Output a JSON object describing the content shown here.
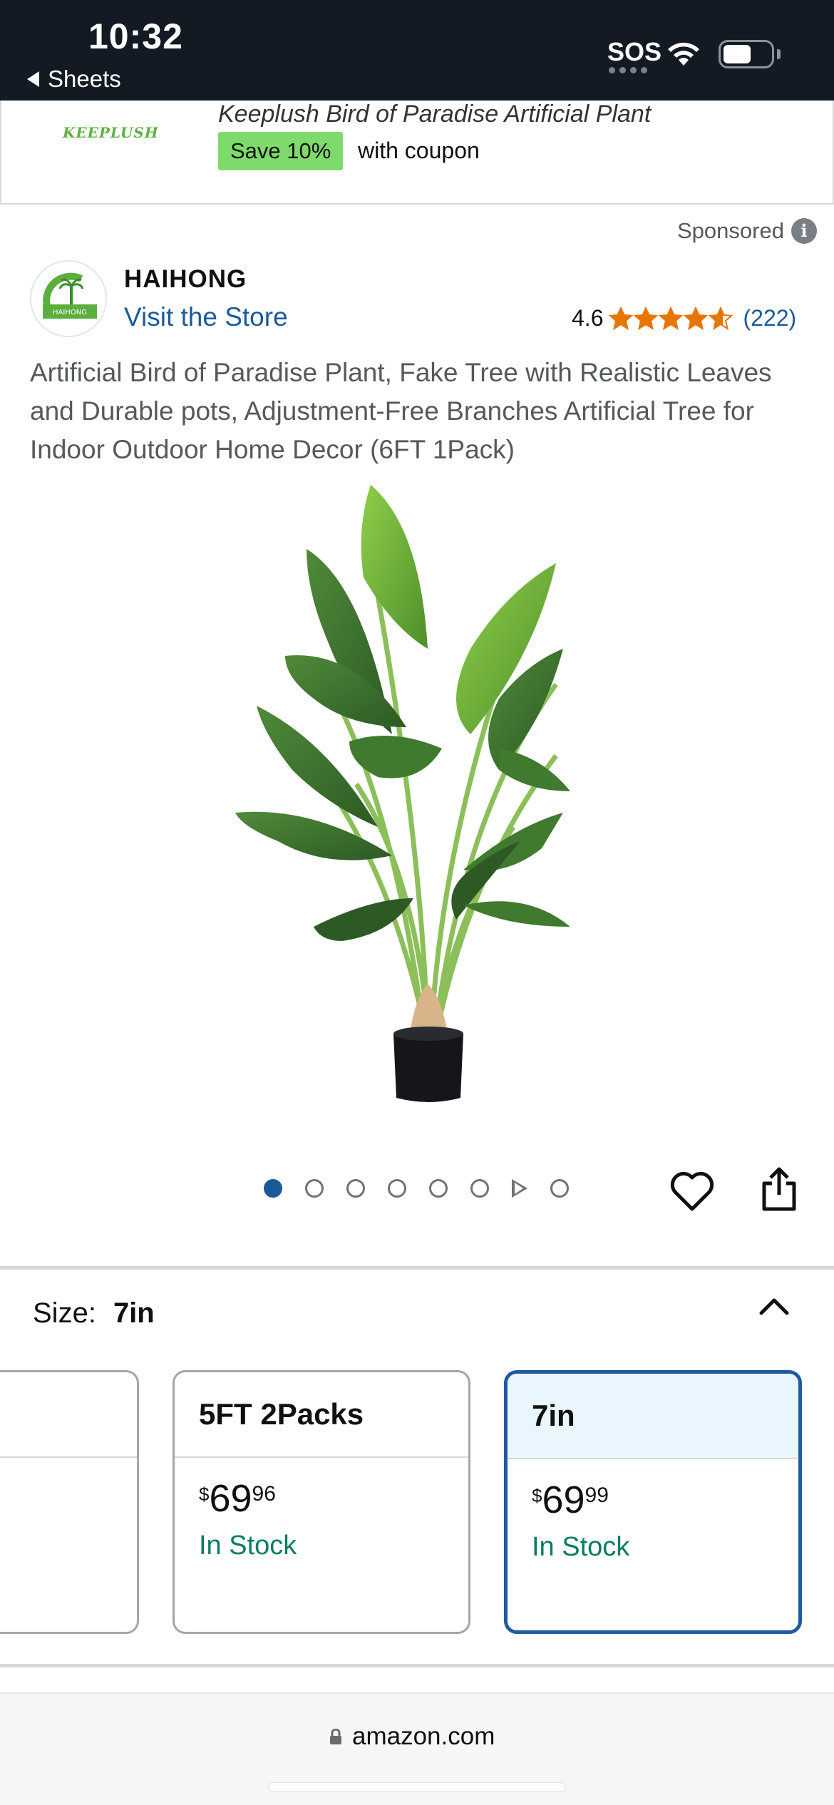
{
  "status_bar": {
    "time": "10:32",
    "back_label": "Sheets",
    "sos": "SOS"
  },
  "banner": {
    "logo_text": "KEEPLUSH",
    "title": "Keeplush Bird of Paradise Artificial Plant",
    "save_badge": "Save 10%",
    "coupon_text": "with coupon"
  },
  "seller": {
    "sponsored_label": "Sponsored",
    "brand": "HAIHONG",
    "visit_store": "Visit the Store",
    "rating_value": "4.6",
    "rating_stars": 4.6,
    "rating_count": "(222)",
    "logo_text": "HAIHONG"
  },
  "product": {
    "title": "Artificial Bird of Paradise Plant, Fake Tree with Realistic Leaves and Durable pots, Adjustment-Free Branches Artificial Tree for Indoor Outdoor Home Decor (6FT 1Pack)",
    "image_count": 8,
    "active_image": 1
  },
  "size": {
    "label": "Size:",
    "selected": "7in",
    "options": [
      {
        "name": "5FT 2Packs",
        "price_symbol": "$",
        "price_whole": "69",
        "price_fraction": "96",
        "stock": "In Stock"
      },
      {
        "name": "7in",
        "price_symbol": "$",
        "price_whole": "69",
        "price_fraction": "99",
        "stock": "In Stock"
      }
    ]
  },
  "browser": {
    "url": "amazon.com"
  },
  "colors": {
    "status_bar_bg": "#141a24",
    "link_blue": "#1b5a99",
    "star_orange": "#e77600",
    "in_stock_green": "#067d62",
    "coupon_green": "#7fda6c",
    "selected_border": "#1f5aa2"
  }
}
